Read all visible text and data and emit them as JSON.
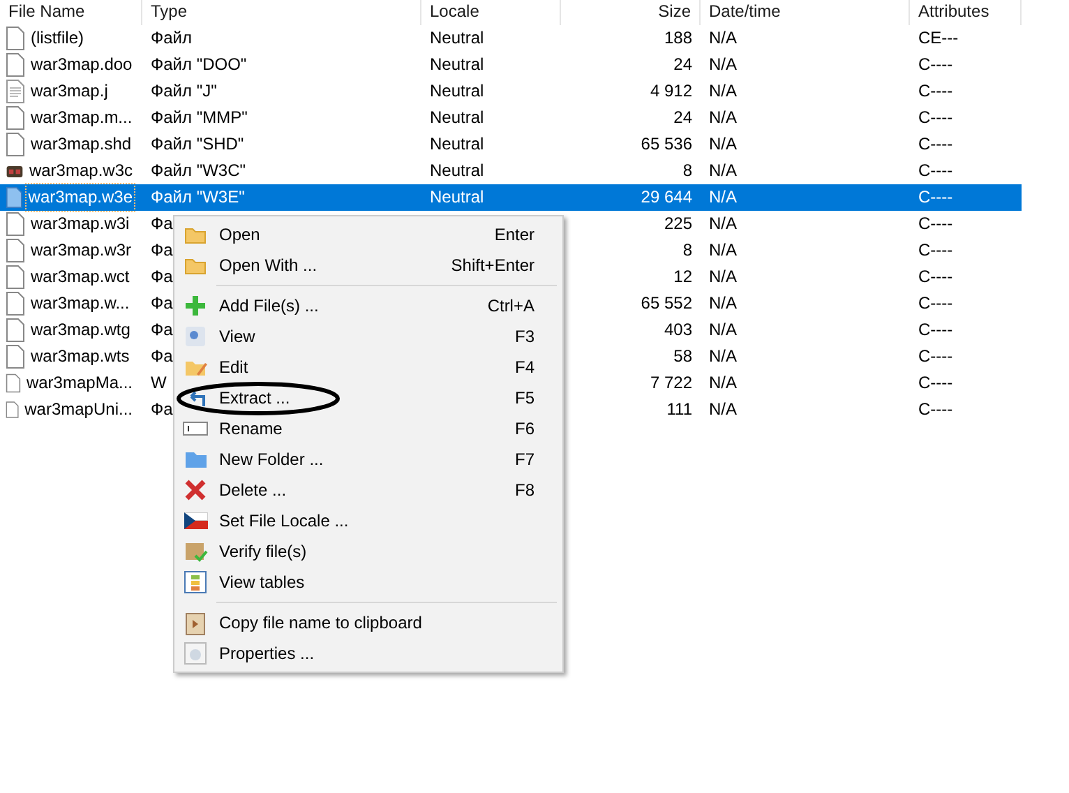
{
  "table": {
    "columns": [
      {
        "label": "File Name"
      },
      {
        "label": "Type"
      },
      {
        "label": "Locale"
      },
      {
        "label": "Size"
      },
      {
        "label": "Date/time"
      },
      {
        "label": "Attributes"
      }
    ],
    "rows": [
      {
        "kind": "document",
        "name": "(listfile)",
        "type": "Файл",
        "locale": "Neutral",
        "size": "188",
        "date": "N/A",
        "attributes": "CE---",
        "selected": false
      },
      {
        "kind": "document",
        "name": "war3map.doo",
        "type": "Файл \"DOO\"",
        "locale": "Neutral",
        "size": "24",
        "date": "N/A",
        "attributes": "C----",
        "selected": false
      },
      {
        "kind": "text",
        "name": "war3map.j",
        "type": "Файл \"J\"",
        "locale": "Neutral",
        "size": "4 912",
        "date": "N/A",
        "attributes": "C----",
        "selected": false
      },
      {
        "kind": "document",
        "name": "war3map.m...",
        "type": "Файл \"MMP\"",
        "locale": "Neutral",
        "size": "24",
        "date": "N/A",
        "attributes": "C----",
        "selected": false
      },
      {
        "kind": "document",
        "name": "war3map.shd",
        "type": "Файл \"SHD\"",
        "locale": "Neutral",
        "size": "65 536",
        "date": "N/A",
        "attributes": "C----",
        "selected": false
      },
      {
        "kind": "special",
        "name": "war3map.w3c",
        "type": "Файл \"W3C\"",
        "locale": "Neutral",
        "size": "8",
        "date": "N/A",
        "attributes": "C----",
        "selected": false
      },
      {
        "kind": "document",
        "name": "war3map.w3e",
        "type": "Файл \"W3E\"",
        "locale": "Neutral",
        "size": "29 644",
        "date": "N/A",
        "attributes": "C----",
        "selected": true
      },
      {
        "kind": "document",
        "name": "war3map.w3i",
        "type": "Фа",
        "size": "225",
        "date": "N/A",
        "attributes": "C----",
        "selected": false
      },
      {
        "kind": "document",
        "name": "war3map.w3r",
        "type": "Фа",
        "size": "8",
        "date": "N/A",
        "attributes": "C----",
        "selected": false
      },
      {
        "kind": "document",
        "name": "war3map.wct",
        "type": "Фа",
        "size": "12",
        "date": "N/A",
        "attributes": "C----",
        "selected": false
      },
      {
        "kind": "document",
        "name": "war3map.w...",
        "type": "Фа",
        "size": "65 552",
        "date": "N/A",
        "attributes": "C----",
        "selected": false
      },
      {
        "kind": "document",
        "name": "war3map.wtg",
        "type": "Фа",
        "size": "403",
        "date": "N/A",
        "attributes": "C----",
        "selected": false
      },
      {
        "kind": "document",
        "name": "war3map.wts",
        "type": "Фа",
        "size": "58",
        "date": "N/A",
        "attributes": "C----",
        "selected": false
      },
      {
        "kind": "document",
        "name": "war3mapMa...",
        "type": "W",
        "size": "7 722",
        "date": "N/A",
        "attributes": "C----",
        "selected": false
      },
      {
        "kind": "document",
        "name": "war3mapUni...",
        "type": "Фа",
        "size": "111",
        "date": "N/A",
        "attributes": "C----",
        "selected": false
      }
    ]
  },
  "context_menu": {
    "items": [
      {
        "kind": "item",
        "label": "Open",
        "shortcut": "Enter"
      },
      {
        "kind": "item",
        "label": "Open With ...",
        "shortcut": "Shift+Enter"
      },
      {
        "kind": "separator"
      },
      {
        "kind": "item",
        "label": "Add File(s) ...",
        "shortcut": "Ctrl+A"
      },
      {
        "kind": "item",
        "label": "View",
        "shortcut": "F3"
      },
      {
        "kind": "item",
        "label": "Edit",
        "shortcut": "F4"
      },
      {
        "kind": "item",
        "label": "Extract ...",
        "shortcut": "F5"
      },
      {
        "kind": "item",
        "label": "Rename",
        "shortcut": "F6"
      },
      {
        "kind": "item",
        "label": "New Folder ...",
        "shortcut": "F7"
      },
      {
        "kind": "item",
        "label": "Delete ...",
        "shortcut": "F8"
      },
      {
        "kind": "item",
        "label": "Set File Locale ..."
      },
      {
        "kind": "item",
        "label": "Verify file(s)"
      },
      {
        "kind": "item",
        "label": "View tables"
      },
      {
        "kind": "separator"
      },
      {
        "kind": "item",
        "label": "Copy file name to clipboard"
      },
      {
        "kind": "item",
        "label": "Properties ..."
      }
    ]
  }
}
